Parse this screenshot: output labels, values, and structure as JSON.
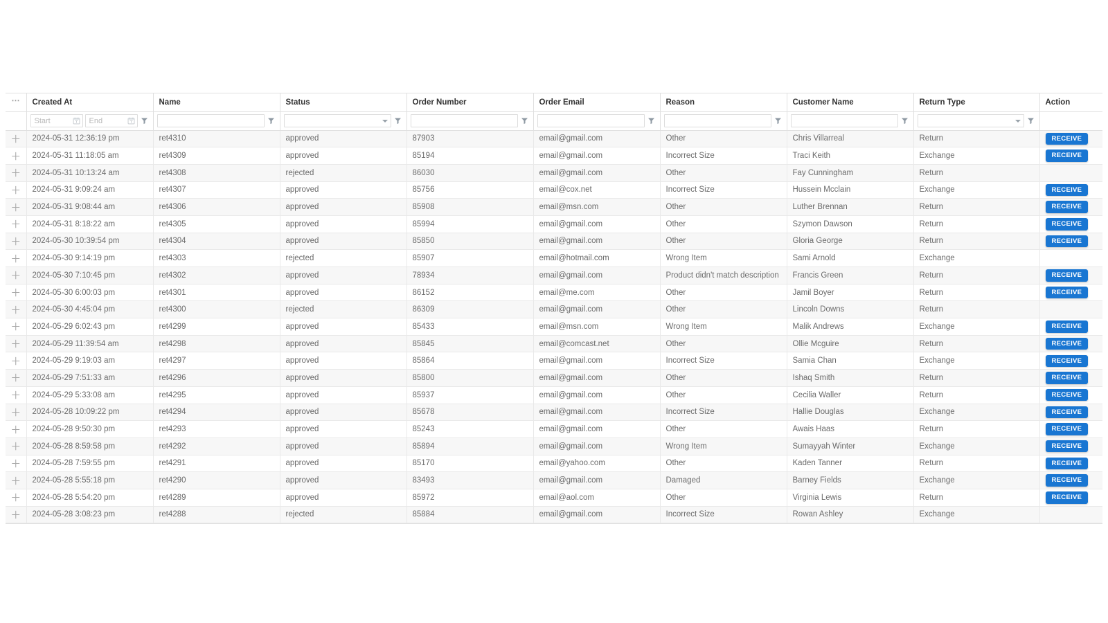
{
  "grid": {
    "expand_column_header_icon": "ellipsis-icon",
    "row_expand_icon": "plus-icon",
    "filter_icon": "funnel-icon",
    "calendar_icon": "calendar-icon",
    "dropdown_icon": "chevron-down-icon",
    "accent_color": "#1976d2",
    "header_text_color": "#333333",
    "cell_text_color": "#6b6b6b",
    "row_stripe_color": "#f7f7f7",
    "columns": [
      {
        "key": "created_at",
        "label": "Created At",
        "filter": "daterange"
      },
      {
        "key": "name",
        "label": "Name",
        "filter": "text"
      },
      {
        "key": "status",
        "label": "Status",
        "filter": "select"
      },
      {
        "key": "order_number",
        "label": "Order Number",
        "filter": "text"
      },
      {
        "key": "order_email",
        "label": "Order Email",
        "filter": "text"
      },
      {
        "key": "reason",
        "label": "Reason",
        "filter": "text"
      },
      {
        "key": "customer_name",
        "label": "Customer Name",
        "filter": "text"
      },
      {
        "key": "return_type",
        "label": "Return Type",
        "filter": "select"
      },
      {
        "key": "action",
        "label": "Action",
        "filter": "none"
      }
    ],
    "filters": {
      "date_start_placeholder": "Start",
      "date_end_placeholder": "End",
      "date_start_value": "",
      "date_end_value": "",
      "name_value": "",
      "status_value": "",
      "order_number_value": "",
      "order_email_value": "",
      "reason_value": "",
      "customer_name_value": "",
      "return_type_value": ""
    },
    "action_button_label": "RECEIVE",
    "rows": [
      {
        "created_at": "2024-05-31 12:36:19 pm",
        "name": "ret4310",
        "status": "approved",
        "order_number": "87903",
        "order_email": "email@gmail.com",
        "reason": "Other",
        "customer_name": "Chris Villarreal",
        "return_type": "Return",
        "action": "RECEIVE"
      },
      {
        "created_at": "2024-05-31 11:18:05 am",
        "name": "ret4309",
        "status": "approved",
        "order_number": "85194",
        "order_email": "email@gmail.com",
        "reason": "Incorrect Size",
        "customer_name": "Traci Keith",
        "return_type": "Exchange",
        "action": "RECEIVE"
      },
      {
        "created_at": "2024-05-31 10:13:24 am",
        "name": "ret4308",
        "status": "rejected",
        "order_number": "86030",
        "order_email": "email@gmail.com",
        "reason": "Other",
        "customer_name": "Fay Cunningham",
        "return_type": "Return",
        "action": ""
      },
      {
        "created_at": "2024-05-31 9:09:24 am",
        "name": "ret4307",
        "status": "approved",
        "order_number": "85756",
        "order_email": "email@cox.net",
        "reason": "Incorrect Size",
        "customer_name": "Hussein Mcclain",
        "return_type": "Exchange",
        "action": "RECEIVE"
      },
      {
        "created_at": "2024-05-31 9:08:44 am",
        "name": "ret4306",
        "status": "approved",
        "order_number": "85908",
        "order_email": "email@msn.com",
        "reason": "Other",
        "customer_name": "Luther Brennan",
        "return_type": "Return",
        "action": "RECEIVE"
      },
      {
        "created_at": "2024-05-31 8:18:22 am",
        "name": "ret4305",
        "status": "approved",
        "order_number": "85994",
        "order_email": "email@gmail.com",
        "reason": "Other",
        "customer_name": "Szymon Dawson",
        "return_type": "Return",
        "action": "RECEIVE"
      },
      {
        "created_at": "2024-05-30 10:39:54 pm",
        "name": "ret4304",
        "status": "approved",
        "order_number": "85850",
        "order_email": "email@gmail.com",
        "reason": "Other",
        "customer_name": "Gloria George",
        "return_type": "Return",
        "action": "RECEIVE"
      },
      {
        "created_at": "2024-05-30 9:14:19 pm",
        "name": "ret4303",
        "status": "rejected",
        "order_number": "85907",
        "order_email": "email@hotmail.com",
        "reason": "Wrong Item",
        "customer_name": "Sami Arnold",
        "return_type": "Exchange",
        "action": ""
      },
      {
        "created_at": "2024-05-30 7:10:45 pm",
        "name": "ret4302",
        "status": "approved",
        "order_number": "78934",
        "order_email": "email@gmail.com",
        "reason": "Product didn't match description",
        "customer_name": "Francis Green",
        "return_type": "Return",
        "action": "RECEIVE"
      },
      {
        "created_at": "2024-05-30 6:00:03 pm",
        "name": "ret4301",
        "status": "approved",
        "order_number": "86152",
        "order_email": "email@me.com",
        "reason": "Other",
        "customer_name": "Jamil Boyer",
        "return_type": "Return",
        "action": "RECEIVE"
      },
      {
        "created_at": "2024-05-30 4:45:04 pm",
        "name": "ret4300",
        "status": "rejected",
        "order_number": "86309",
        "order_email": "email@gmail.com",
        "reason": "Other",
        "customer_name": "Lincoln Downs",
        "return_type": "Return",
        "action": ""
      },
      {
        "created_at": "2024-05-29 6:02:43 pm",
        "name": "ret4299",
        "status": "approved",
        "order_number": "85433",
        "order_email": "email@msn.com",
        "reason": "Wrong Item",
        "customer_name": "Malik Andrews",
        "return_type": "Exchange",
        "action": "RECEIVE"
      },
      {
        "created_at": "2024-05-29 11:39:54 am",
        "name": "ret4298",
        "status": "approved",
        "order_number": "85845",
        "order_email": "email@comcast.net",
        "reason": "Other",
        "customer_name": "Ollie Mcguire",
        "return_type": "Return",
        "action": "RECEIVE"
      },
      {
        "created_at": "2024-05-29 9:19:03 am",
        "name": "ret4297",
        "status": "approved",
        "order_number": "85864",
        "order_email": "email@gmail.com",
        "reason": "Incorrect Size",
        "customer_name": "Samia Chan",
        "return_type": "Exchange",
        "action": "RECEIVE"
      },
      {
        "created_at": "2024-05-29 7:51:33 am",
        "name": "ret4296",
        "status": "approved",
        "order_number": "85800",
        "order_email": "email@gmail.com",
        "reason": "Other",
        "customer_name": "Ishaq Smith",
        "return_type": "Return",
        "action": "RECEIVE"
      },
      {
        "created_at": "2024-05-29 5:33:08 am",
        "name": "ret4295",
        "status": "approved",
        "order_number": "85937",
        "order_email": "email@gmail.com",
        "reason": "Other",
        "customer_name": "Cecilia Waller",
        "return_type": "Return",
        "action": "RECEIVE"
      },
      {
        "created_at": "2024-05-28 10:09:22 pm",
        "name": "ret4294",
        "status": "approved",
        "order_number": "85678",
        "order_email": "email@gmail.com",
        "reason": "Incorrect Size",
        "customer_name": "Hallie Douglas",
        "return_type": "Exchange",
        "action": "RECEIVE"
      },
      {
        "created_at": "2024-05-28 9:50:30 pm",
        "name": "ret4293",
        "status": "approved",
        "order_number": "85243",
        "order_email": "email@gmail.com",
        "reason": "Other",
        "customer_name": "Awais Haas",
        "return_type": "Return",
        "action": "RECEIVE"
      },
      {
        "created_at": "2024-05-28 8:59:58 pm",
        "name": "ret4292",
        "status": "approved",
        "order_number": "85894",
        "order_email": "email@gmail.com",
        "reason": "Wrong Item",
        "customer_name": "Sumayyah Winter",
        "return_type": "Exchange",
        "action": "RECEIVE"
      },
      {
        "created_at": "2024-05-28 7:59:55 pm",
        "name": "ret4291",
        "status": "approved",
        "order_number": "85170",
        "order_email": "email@yahoo.com",
        "reason": "Other",
        "customer_name": "Kaden Tanner",
        "return_type": "Return",
        "action": "RECEIVE"
      },
      {
        "created_at": "2024-05-28 5:55:18 pm",
        "name": "ret4290",
        "status": "approved",
        "order_number": "83493",
        "order_email": "email@gmail.com",
        "reason": "Damaged",
        "customer_name": "Barney Fields",
        "return_type": "Exchange",
        "action": "RECEIVE"
      },
      {
        "created_at": "2024-05-28 5:54:20 pm",
        "name": "ret4289",
        "status": "approved",
        "order_number": "85972",
        "order_email": "email@aol.com",
        "reason": "Other",
        "customer_name": "Virginia Lewis",
        "return_type": "Return",
        "action": "RECEIVE"
      },
      {
        "created_at": "2024-05-28 3:08:23 pm",
        "name": "ret4288",
        "status": "rejected",
        "order_number": "85884",
        "order_email": "email@gmail.com",
        "reason": "Incorrect Size",
        "customer_name": "Rowan Ashley",
        "return_type": "Exchange",
        "action": ""
      }
    ]
  }
}
